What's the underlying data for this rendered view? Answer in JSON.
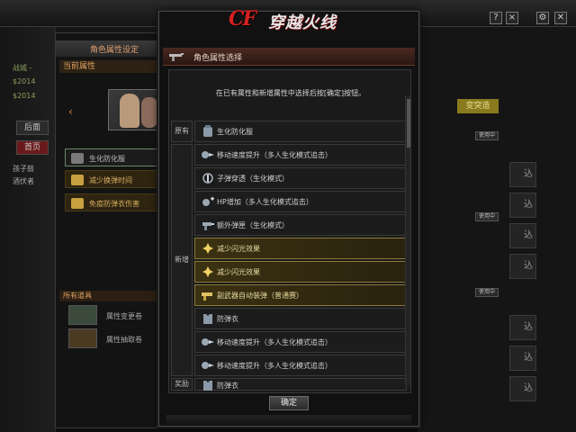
{
  "logo": {
    "cf": "CF",
    "name": "穿越火线"
  },
  "background": {
    "top_buttons": [
      "?",
      "×"
    ],
    "left_list": [
      "战城 -",
      "$2014",
      "$2014",
      "后面",
      "首页",
      "孩子鼓",
      "酒伏者"
    ],
    "right_tags": [
      "使用中",
      "使用中",
      "使用中"
    ],
    "right_buttons": [
      "込",
      "込",
      "込",
      "込",
      "込",
      "込",
      "込"
    ],
    "right_special": "变突造"
  },
  "attr_dialog": {
    "title": "角色属性设定",
    "subtitle": "当前属性",
    "rows": [
      "生化防化服",
      "减少换弹时间",
      "免疫防弹衣伤害"
    ],
    "section": "所有道具",
    "cards": [
      "属性变更卷",
      "属性抽取卷"
    ]
  },
  "modal": {
    "title": "角色属性选择",
    "instruction": "在已有属性和新增属性中选择后按[确定]按钮。",
    "categories": {
      "existing": "原有",
      "added": "新增",
      "reward": "奖励"
    },
    "items_existing": [
      {
        "label": "生化防化服",
        "icon": "armor-icon",
        "gold": false
      }
    ],
    "items_added": [
      {
        "label": "移动速度提升（多人生化模式追击）",
        "icon": "speed-icon",
        "gold": false
      },
      {
        "label": "子弹穿透（生化模式）",
        "icon": "bullet-icon",
        "gold": false
      },
      {
        "label": "HP增加（多人生化模式追击）",
        "icon": "hp-icon",
        "gold": false
      },
      {
        "label": "额外弹匣（生化模式）",
        "icon": "magazine-icon",
        "gold": false
      },
      {
        "label": "减少闪光效果",
        "icon": "flash-icon",
        "gold": true
      },
      {
        "label": "减少闪光效果",
        "icon": "flash-icon",
        "gold": true
      },
      {
        "label": "副武器自动装弹（普通赛）",
        "icon": "pistol-icon",
        "gold": true
      },
      {
        "label": "防弹衣",
        "icon": "vest-icon",
        "gold": false
      },
      {
        "label": "移动速度提升（多人生化模式追击）",
        "icon": "speed-icon",
        "gold": false
      },
      {
        "label": "移动速度提升（多人生化模式追击）",
        "icon": "speed-icon",
        "gold": false
      }
    ],
    "items_reward": [
      {
        "label": "防弹衣",
        "icon": "vest-icon",
        "gold": false
      }
    ],
    "confirm_label": "确定",
    "colors": {
      "gold_row": "#3b3112",
      "title_bar": "#4a2a22"
    }
  }
}
